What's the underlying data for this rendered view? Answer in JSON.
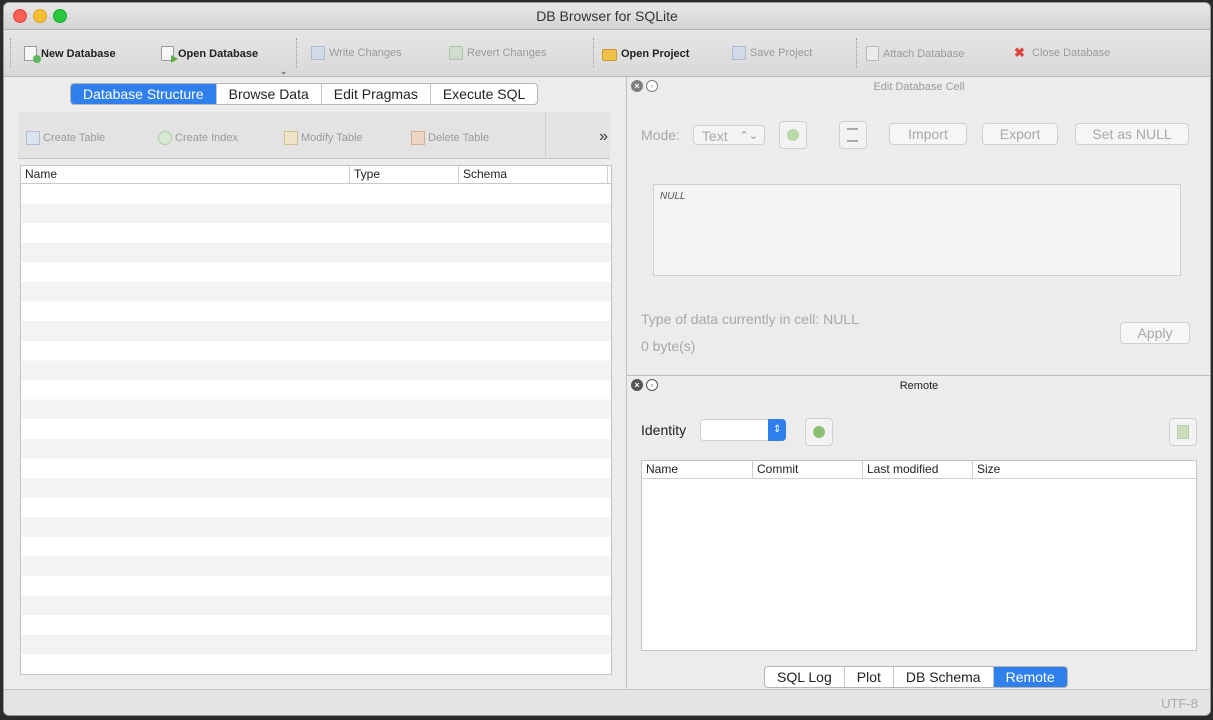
{
  "window": {
    "title": "DB Browser for SQLite"
  },
  "toolbar": {
    "new_database": "New Database",
    "open_database": "Open Database",
    "write_changes": "Write Changes",
    "revert_changes": "Revert Changes",
    "open_project": "Open Project",
    "save_project": "Save Project",
    "attach_database": "Attach Database",
    "close_database": "Close Database"
  },
  "main_tabs": [
    "Database Structure",
    "Browse Data",
    "Edit Pragmas",
    "Execute SQL"
  ],
  "structure_toolbar": {
    "create_table": "Create Table",
    "create_index": "Create Index",
    "modify_table": "Modify Table",
    "delete_table": "Delete Table",
    "more": "»"
  },
  "structure_table": {
    "columns": [
      "Name",
      "Type",
      "Schema"
    ]
  },
  "edit_cell": {
    "title": "Edit Database Cell",
    "mode_label": "Mode:",
    "mode_value": "Text",
    "import": "Import",
    "export": "Export",
    "set_null": "Set as NULL",
    "cell_value": "NULL",
    "type_info": "Type of data currently in cell: NULL",
    "size_info": "0 byte(s)",
    "apply": "Apply"
  },
  "remote": {
    "title": "Remote",
    "identity_label": "Identity",
    "columns": [
      "Name",
      "Commit",
      "Last modified",
      "Size"
    ]
  },
  "bottom_tabs": [
    "SQL Log",
    "Plot",
    "DB Schema",
    "Remote"
  ],
  "status": {
    "encoding": "UTF-8"
  }
}
